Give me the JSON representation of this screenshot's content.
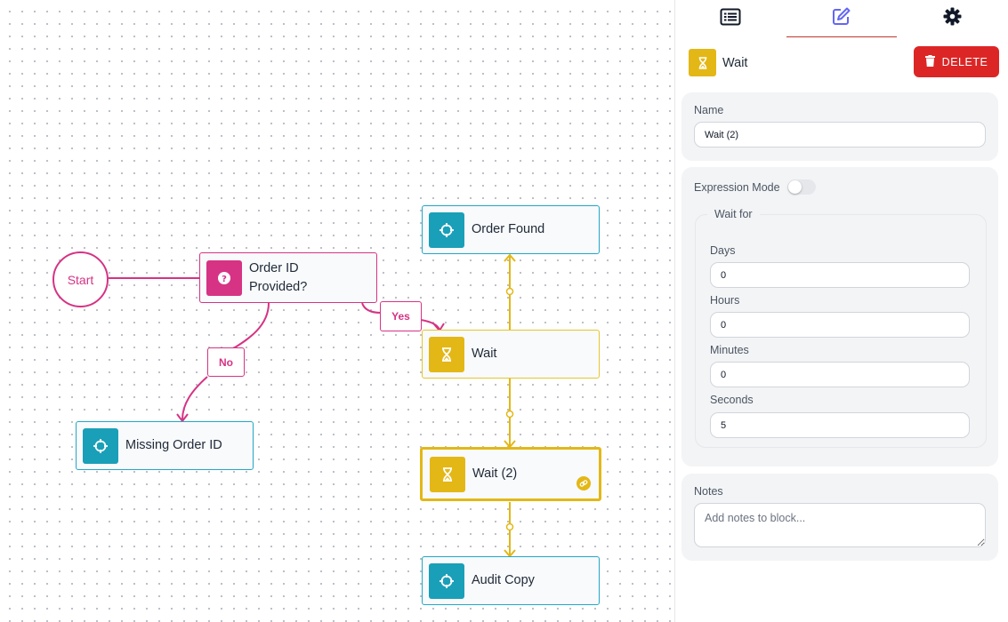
{
  "canvas": {
    "start_label": "Start",
    "edge_labels": {
      "yes": "Yes",
      "no": "No"
    },
    "nodes": {
      "order_id_provided": {
        "label": "Order ID Provided?",
        "icon": "question-circle-icon"
      },
      "order_found": {
        "label": "Order Found",
        "icon": "crosshair-icon"
      },
      "wait": {
        "label": "Wait",
        "icon": "hourglass-icon"
      },
      "wait2": {
        "label": "Wait (2)",
        "icon": "hourglass-icon"
      },
      "missing_order_id": {
        "label": "Missing Order ID",
        "icon": "crosshair-icon"
      },
      "audit_copy": {
        "label": "Audit Copy",
        "icon": "crosshair-icon"
      }
    }
  },
  "panel": {
    "tabs": [
      {
        "name": "list",
        "icon": "list-icon",
        "active": false
      },
      {
        "name": "edit",
        "icon": "edit-icon",
        "active": true
      },
      {
        "name": "settings",
        "icon": "gear-icon",
        "active": false
      }
    ],
    "block_title": "Wait",
    "delete_label": "DELETE",
    "name_label": "Name",
    "name_value": "Wait (2)",
    "expression_mode_label": "Expression Mode",
    "expression_mode_on": false,
    "wait_for_label": "Wait for",
    "fields": {
      "days": {
        "label": "Days",
        "value": "0"
      },
      "hours": {
        "label": "Hours",
        "value": "0"
      },
      "minutes": {
        "label": "Minutes",
        "value": "0"
      },
      "seconds": {
        "label": "Seconds",
        "value": "5"
      }
    },
    "notes_label": "Notes",
    "notes_placeholder": "Add notes to block..."
  },
  "colors": {
    "action": "#1a9fb8",
    "wait": "#e3b716",
    "condition": "#d63384",
    "delete": "#dc2626",
    "active_tab": "#6366f1"
  }
}
